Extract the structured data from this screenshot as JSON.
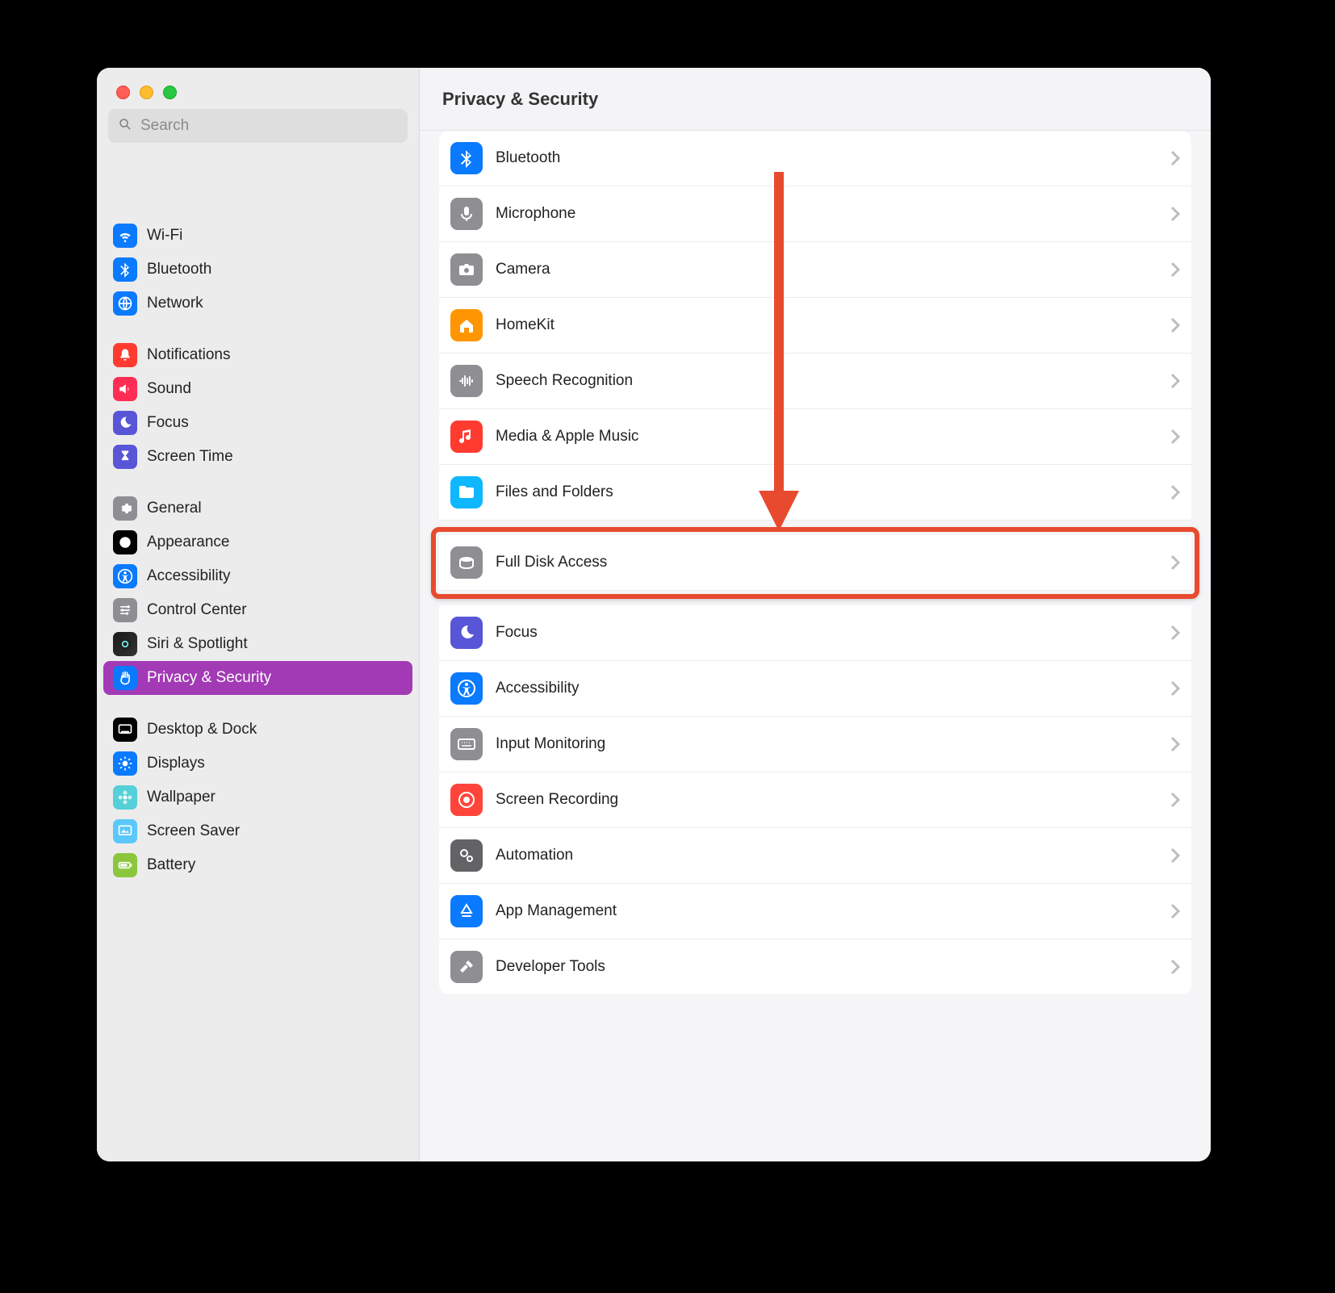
{
  "window": {
    "title": "Privacy & Security"
  },
  "search": {
    "placeholder": "Search"
  },
  "sidebar": {
    "groups": [
      {
        "items": [
          {
            "id": "wifi",
            "label": "Wi-Fi",
            "icon": "wifi-icon",
            "color": "bg-blue"
          },
          {
            "id": "bluetooth",
            "label": "Bluetooth",
            "icon": "bluetooth-icon",
            "color": "bg-blue"
          },
          {
            "id": "network",
            "label": "Network",
            "icon": "globe-icon",
            "color": "bg-blue"
          }
        ]
      },
      {
        "items": [
          {
            "id": "notifications",
            "label": "Notifications",
            "icon": "bell-icon",
            "color": "bg-red"
          },
          {
            "id": "sound",
            "label": "Sound",
            "icon": "speaker-icon",
            "color": "bg-pink"
          },
          {
            "id": "focus",
            "label": "Focus",
            "icon": "moon-icon",
            "color": "bg-purple"
          },
          {
            "id": "screentime",
            "label": "Screen Time",
            "icon": "hourglass-icon",
            "color": "bg-purple"
          }
        ]
      },
      {
        "items": [
          {
            "id": "general",
            "label": "General",
            "icon": "gear-icon",
            "color": "bg-gray"
          },
          {
            "id": "appearance",
            "label": "Appearance",
            "icon": "appearance-icon",
            "color": "bg-black"
          },
          {
            "id": "accessibility",
            "label": "Accessibility",
            "icon": "accessibility-icon",
            "color": "bg-blue"
          },
          {
            "id": "controlcenter",
            "label": "Control Center",
            "icon": "switches-icon",
            "color": "bg-gray"
          },
          {
            "id": "siri",
            "label": "Siri & Spotlight",
            "icon": "siri-icon",
            "color": "bg-siri"
          },
          {
            "id": "privacy",
            "label": "Privacy & Security",
            "icon": "hand-icon",
            "color": "bg-hand",
            "selected": true
          }
        ]
      },
      {
        "items": [
          {
            "id": "desktop",
            "label": "Desktop & Dock",
            "icon": "dock-icon",
            "color": "bg-black"
          },
          {
            "id": "displays",
            "label": "Displays",
            "icon": "sun-icon",
            "color": "bg-blue"
          },
          {
            "id": "wallpaper",
            "label": "Wallpaper",
            "icon": "flower-icon",
            "color": "bg-teal"
          },
          {
            "id": "screensaver",
            "label": "Screen Saver",
            "icon": "screensaver-icon",
            "color": "bg-sky"
          },
          {
            "id": "battery",
            "label": "Battery",
            "icon": "battery-icon",
            "color": "bg-lime"
          }
        ]
      }
    ]
  },
  "content": {
    "rows": [
      {
        "id": "bluetooth",
        "label": "Bluetooth",
        "icon": "bluetooth-icon",
        "color": "bg-blue"
      },
      {
        "id": "microphone",
        "label": "Microphone",
        "icon": "microphone-icon",
        "color": "bg-gray"
      },
      {
        "id": "camera",
        "label": "Camera",
        "icon": "camera-icon",
        "color": "bg-gray"
      },
      {
        "id": "homekit",
        "label": "HomeKit",
        "icon": "home-icon",
        "color": "bg-orange"
      },
      {
        "id": "speech",
        "label": "Speech Recognition",
        "icon": "waveform-icon",
        "color": "bg-gray"
      },
      {
        "id": "media",
        "label": "Media & Apple Music",
        "icon": "music-icon",
        "color": "bg-red"
      },
      {
        "id": "files",
        "label": "Files and Folders",
        "icon": "folder-icon",
        "color": "bg-cyan"
      },
      {
        "gap": true
      },
      {
        "id": "fulldisk",
        "label": "Full Disk Access",
        "icon": "disk-icon",
        "color": "bg-gray",
        "highlighted": true
      },
      {
        "gap": true
      },
      {
        "id": "focusrow",
        "label": "Focus",
        "icon": "moon-icon",
        "color": "bg-purple"
      },
      {
        "id": "accrow",
        "label": "Accessibility",
        "icon": "accessibility-icon",
        "color": "bg-blue"
      },
      {
        "id": "inputmon",
        "label": "Input Monitoring",
        "icon": "keyboard-icon",
        "color": "bg-gray"
      },
      {
        "id": "screenrec",
        "label": "Screen Recording",
        "icon": "record-icon",
        "color": "bg-redrec"
      },
      {
        "id": "automation",
        "label": "Automation",
        "icon": "gears-icon",
        "color": "bg-darkgray"
      },
      {
        "id": "appmgmt",
        "label": "App Management",
        "icon": "appstore-icon",
        "color": "bg-blue"
      },
      {
        "id": "devtools",
        "label": "Developer Tools",
        "icon": "hammer-icon",
        "color": "bg-gray"
      }
    ]
  },
  "annotation": {
    "highlight_target": "fulldisk",
    "highlight_color": "#e74a2e",
    "arrow_color": "#e74a2e"
  }
}
